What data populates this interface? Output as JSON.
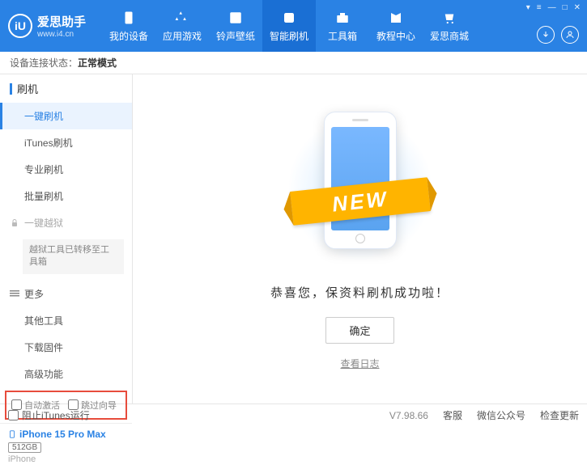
{
  "logo": {
    "icon": "iU",
    "title": "爱思助手",
    "url": "www.i4.cn"
  },
  "nav": {
    "items": [
      {
        "label": "我的设备"
      },
      {
        "label": "应用游戏"
      },
      {
        "label": "铃声壁纸"
      },
      {
        "label": "智能刷机"
      },
      {
        "label": "工具箱"
      },
      {
        "label": "教程中心"
      },
      {
        "label": "爱思商城"
      }
    ]
  },
  "status": {
    "label": "设备连接状态：",
    "value": "正常模式"
  },
  "sidebar": {
    "flash_header": "刷机",
    "items": {
      "onekey": "一键刷机",
      "itunes": "iTunes刷机",
      "pro": "专业刷机",
      "batch": "批量刷机"
    },
    "jailbreak": "一键越狱",
    "jailbreak_notice": "越狱工具已转移至工具箱",
    "more_header": "更多",
    "more": {
      "other": "其他工具",
      "download": "下载固件",
      "advanced": "高级功能"
    },
    "checkboxes": {
      "auto_activate": "自动激活",
      "skip_guide": "跳过向导"
    }
  },
  "device": {
    "name": "iPhone 15 Pro Max",
    "storage": "512GB",
    "type": "iPhone"
  },
  "main": {
    "banner": "NEW",
    "success": "恭喜您，保资料刷机成功啦！",
    "ok": "确定",
    "log": "查看日志"
  },
  "footer": {
    "block_itunes": "阻止iTunes运行",
    "version": "V7.98.66",
    "support": "客服",
    "wechat": "微信公众号",
    "update": "检查更新"
  }
}
